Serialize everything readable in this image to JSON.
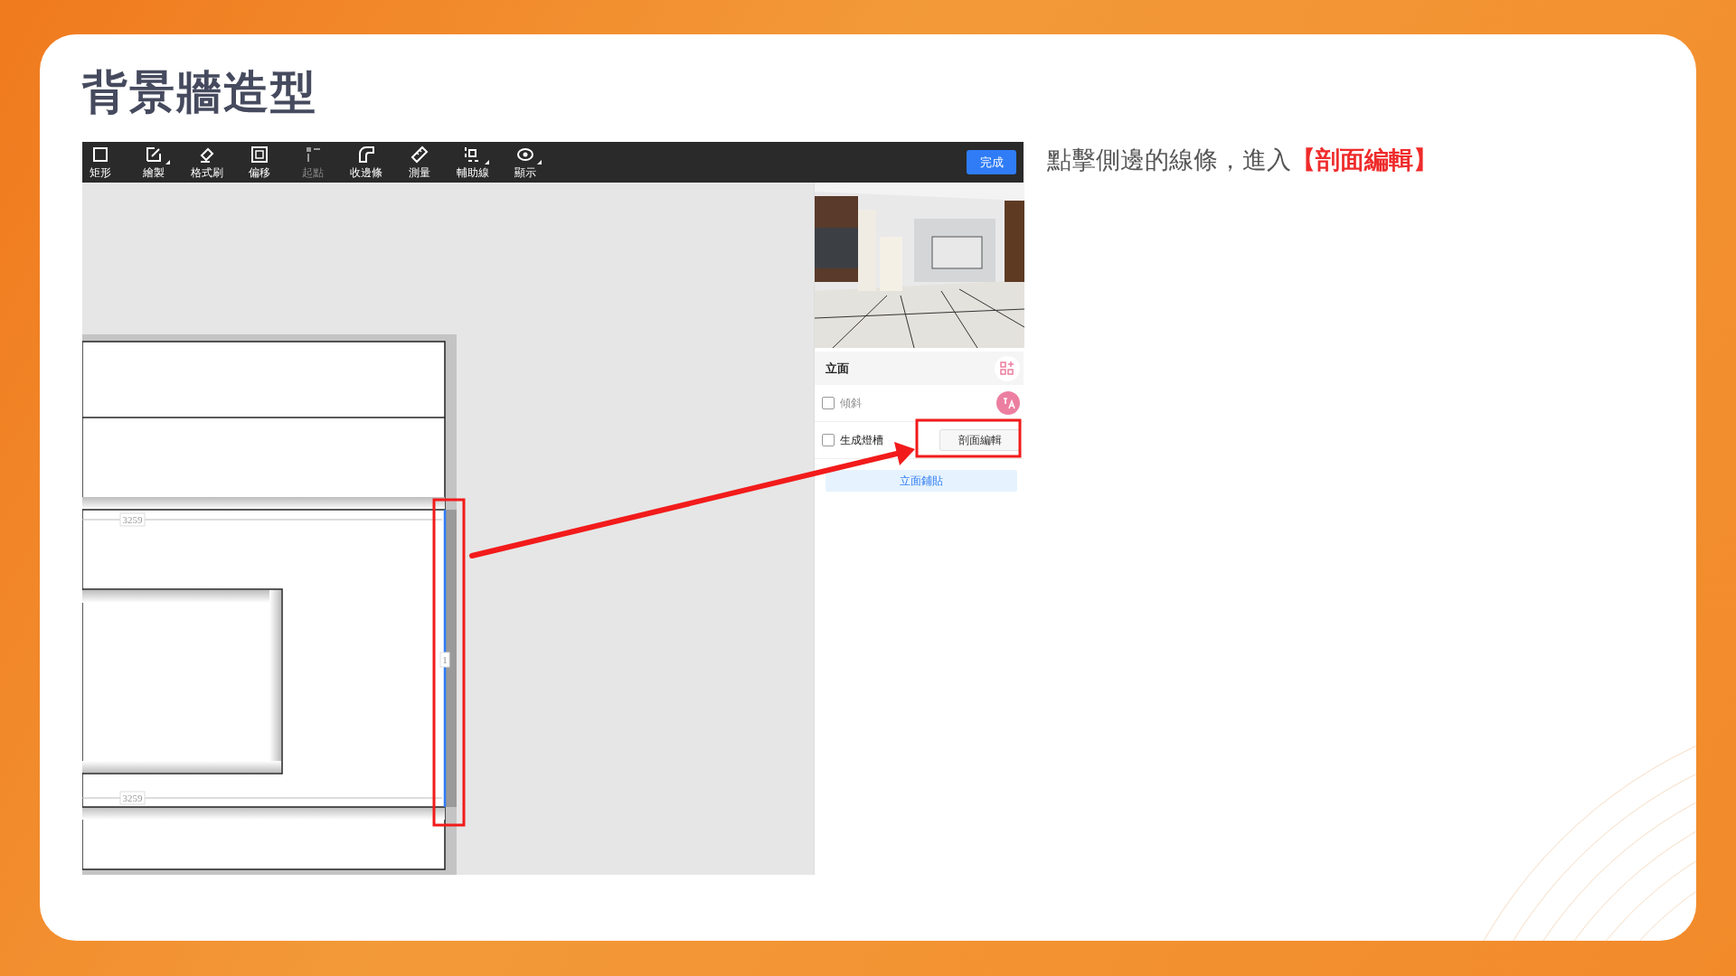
{
  "slide": {
    "title": "背景牆造型",
    "note_parts": [
      {
        "text": "點擊側邊的線條，進入",
        "highlight": false
      },
      {
        "text": "【剖面編輯】",
        "highlight": true
      }
    ]
  },
  "toolbar": {
    "items": [
      {
        "label": "矩形",
        "kind": "square",
        "disabled": false,
        "menu": false
      },
      {
        "label": "繪製",
        "kind": "pencil",
        "disabled": false,
        "menu": true
      },
      {
        "label": "格式刷",
        "kind": "brush",
        "disabled": false,
        "menu": false
      },
      {
        "label": "偏移",
        "kind": "offset",
        "disabled": false,
        "menu": false
      },
      {
        "label": "起點",
        "kind": "start",
        "disabled": true,
        "menu": false
      },
      {
        "label": "收邊條",
        "kind": "trim",
        "disabled": false,
        "menu": false
      },
      {
        "label": "測量",
        "kind": "ruler",
        "disabled": false,
        "menu": false
      },
      {
        "label": "輔助線",
        "kind": "guides",
        "disabled": false,
        "menu": true
      },
      {
        "label": "顯示",
        "kind": "eye",
        "disabled": false,
        "menu": true
      }
    ],
    "done_button": "完成"
  },
  "canvas": {
    "dimension_labels": [
      "3259",
      "3259"
    ],
    "segment_label": "1"
  },
  "panel": {
    "header": "立面",
    "options": [
      {
        "label": "傾斜",
        "checked": false,
        "disabled": true
      },
      {
        "label": "生成燈槽",
        "checked": false,
        "disabled": false,
        "button": "剖面編輯"
      }
    ],
    "bottom_button": "立面鋪貼"
  }
}
